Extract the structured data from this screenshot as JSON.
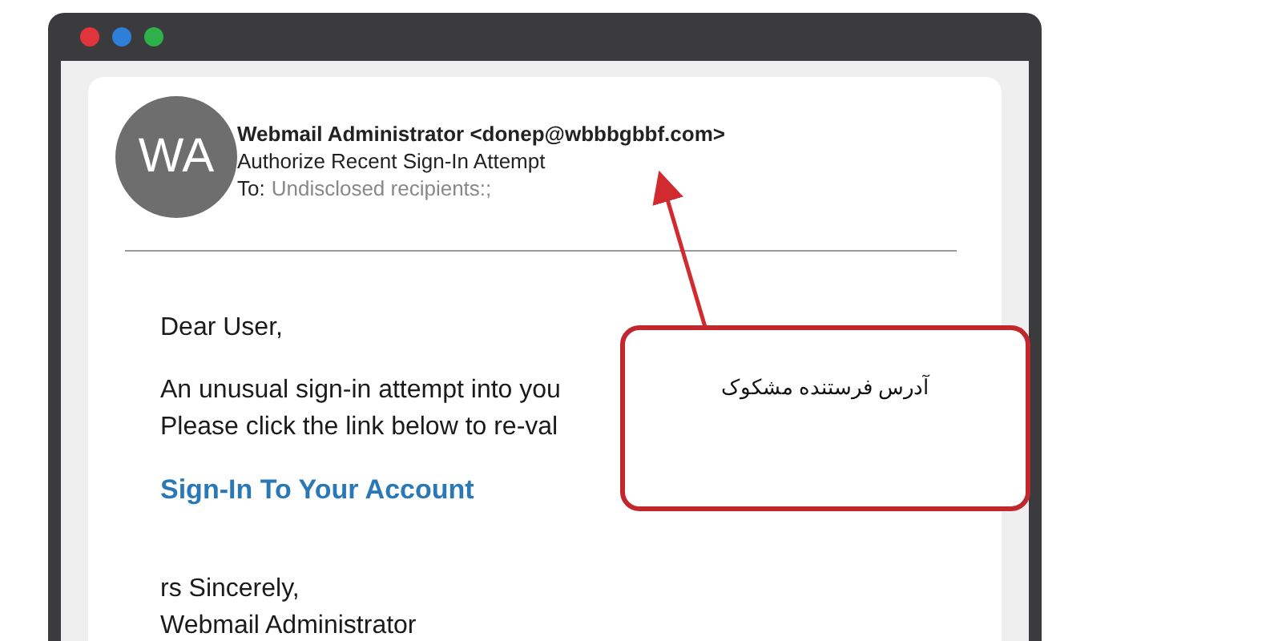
{
  "window": {
    "controls": [
      {
        "color": "#e2343b"
      },
      {
        "color": "#2e7fd8"
      },
      {
        "color": "#2db24b"
      }
    ]
  },
  "email": {
    "avatar": "WA",
    "sender": "Webmail Administrator <donep@wbbbgbbf.com>",
    "subject": "Authorize Recent Sign-In Attempt",
    "to_label": "To:",
    "to_value": "Undisclosed recipients:;",
    "greeting": "Dear User,",
    "body_lines": [
      "An unusual sign-in attempt into you",
      "Please click the link below  to  re-val"
    ],
    "link": "Sign-In To Your Account",
    "closing": "rs Sincerely,",
    "signature": "Webmail Administrator"
  },
  "callout": {
    "text": "آدرس فرستنده مشکوک"
  }
}
